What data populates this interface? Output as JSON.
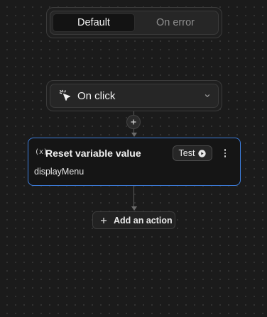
{
  "mode_toggle": {
    "options": [
      {
        "label": "Default",
        "selected": true
      },
      {
        "label": "On error",
        "selected": false
      }
    ]
  },
  "trigger": {
    "icon": "cursor-click-icon",
    "label": "On click",
    "dropdown_icon": "chevron-down-icon"
  },
  "connector": {
    "insert_icon": "plus-icon"
  },
  "action_card": {
    "type_icon_text": "(x)",
    "title": "Reset variable value",
    "test_label": "Test",
    "test_icon": "play-circle-icon",
    "menu_icon": "more-vertical-icon",
    "variable_name": "displayMenu",
    "accent_color": "#3d7fe0"
  },
  "add_action": {
    "icon": "plus-icon",
    "label": "Add an action"
  }
}
